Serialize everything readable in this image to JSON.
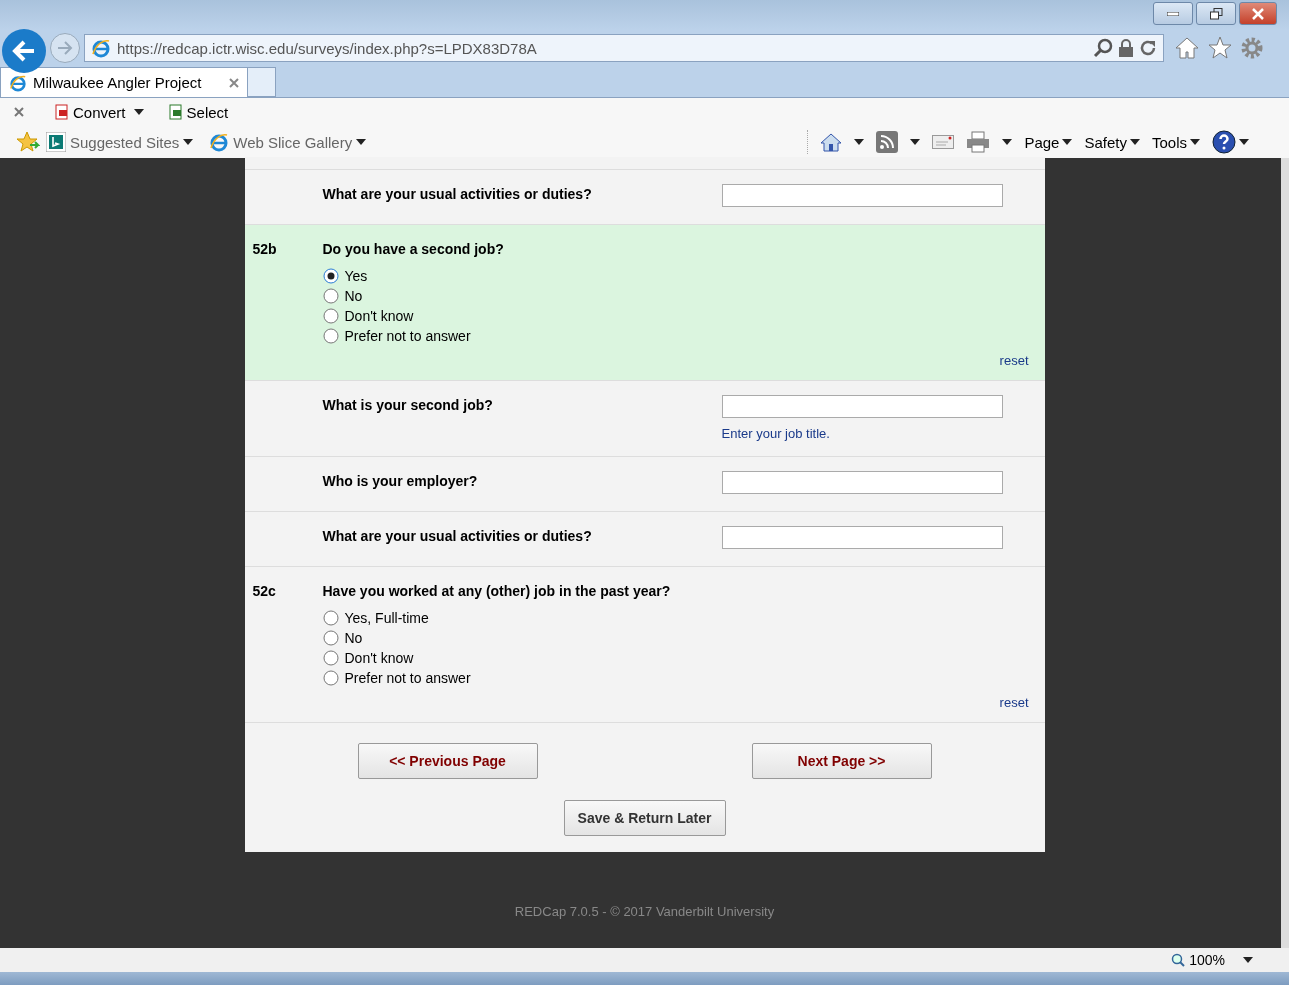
{
  "browser": {
    "address": "https://redcap.ictr.wisc.edu/surveys/index.php?s=LPDX83D78A",
    "tabs": [
      {
        "title": "Milwaukee Angler Project",
        "selected": true
      }
    ],
    "toolbar": [
      "Convert",
      "Select"
    ],
    "favorites": [
      "Suggested Sites",
      "Web Slice Gallery"
    ],
    "commands": [
      "Page",
      "Safety",
      "Tools"
    ],
    "zoom": "100%"
  },
  "survey": {
    "rows": [
      {
        "kind": "text",
        "number": "",
        "question": "What are your usual activities or duties?",
        "highlighted": false
      },
      {
        "kind": "radio",
        "number": "52b",
        "question": "Do you have a second job?",
        "highlighted": true,
        "reset": "reset",
        "options": [
          {
            "label": "Yes",
            "selected": true
          },
          {
            "label": "No",
            "selected": false
          },
          {
            "label": "Don't know",
            "selected": false
          },
          {
            "label": "Prefer not to answer",
            "selected": false
          }
        ]
      },
      {
        "kind": "text",
        "number": "",
        "question": "What is your second job?",
        "highlighted": false,
        "note": "Enter your job title."
      },
      {
        "kind": "text",
        "number": "",
        "question": "Who is your employer?",
        "highlighted": false
      },
      {
        "kind": "text",
        "number": "",
        "question": "What are your usual activities or duties?",
        "highlighted": false
      },
      {
        "kind": "radio",
        "number": "52c",
        "question": "Have you worked at any (other) job in the past year?",
        "highlighted": false,
        "reset": "reset",
        "options": [
          {
            "label": "Yes, Full-time",
            "selected": false
          },
          {
            "label": "No",
            "selected": false
          },
          {
            "label": "Don't know",
            "selected": false
          },
          {
            "label": "Prefer not to answer",
            "selected": false
          }
        ]
      }
    ],
    "buttons": {
      "previous": "<< Previous Page",
      "next": "Next Page >>",
      "save": "Save & Return Later"
    },
    "footer": "REDCap 7.0.5 - © 2017 Vanderbilt University"
  }
}
